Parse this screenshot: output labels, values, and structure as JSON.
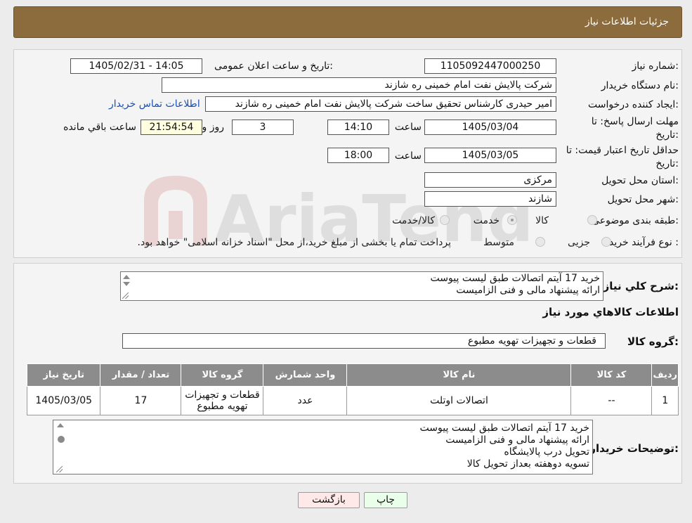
{
  "header": {
    "title": "جزئیات اطلاعات نیاز"
  },
  "form": {
    "need_number": {
      "label": "شماره نیاز:",
      "value": "1105092447000250"
    },
    "announce_datetime": {
      "label": "تاریخ و ساعت اعلان عمومی:",
      "value": "1405/02/31 - 14:05"
    },
    "buyer_org": {
      "label": "نام دستگاه خریدار:",
      "value": "شرکت پالایش نفت امام خمینی  ره  شازند"
    },
    "requester": {
      "label": "ایجاد کننده درخواست:",
      "value": "امیر  حیدری کارشناس تحقیق ساخت شرکت پالایش نفت امام خمینی  ره  شازند",
      "contact_link": "اطلاعات تماس خریدار"
    },
    "reply_deadline": {
      "label": "مهلت ارسال پاسخ: تا",
      "label2": "تاریخ:",
      "date": "1405/03/04",
      "time_label": "ساعت",
      "time": "14:10",
      "days": "3",
      "days_label": "روز و",
      "remaining": "21:54:54",
      "remaining_label": "ساعت باقي مانده"
    },
    "price_validity": {
      "label": "حداقل تاریخ اعتبار قیمت: تا",
      "label2": "تاریخ:",
      "date": "1405/03/05",
      "time_label": "ساعت",
      "time": "18:00"
    },
    "province": {
      "label": "استان محل تحویل:",
      "value": "مرکزی"
    },
    "city": {
      "label": "شهر محل تحویل:",
      "value": "شازند"
    },
    "category": {
      "label": "طبقه بندی موضوعی:",
      "options": [
        "کالا",
        "خدمت",
        "کالا/خدمت"
      ]
    },
    "purchase_type": {
      "label": "نوع فرآیند خرید :",
      "options": [
        "جزیی",
        "متوسط"
      ],
      "note": "پرداخت تمام یا بخشی از مبلغ خرید،از محل \"اسناد خزانه اسلامی\" خواهد بود."
    }
  },
  "summary": {
    "label": "شرح كلي نياز:",
    "lines": [
      "خرید 17 آیتم اتصالات طبق لیست پیوست",
      "ارائه پیشنهاد مالی و فنی الزامیست"
    ]
  },
  "items_section": {
    "title": "اطلاعات كالاهاي مورد نياز",
    "group_label": "گروه كالا:",
    "group_value": "قطعات و تجهیزات تهویه مطبوع"
  },
  "table": {
    "headers": [
      "ردیف",
      "کد کالا",
      "نام کالا",
      "واحد شمارش",
      "گروه کالا",
      "تعداد / مقدار",
      "تاریخ نیاز"
    ],
    "row": [
      "1",
      "--",
      "اتصالات اوتلت",
      "عدد",
      "قطعات و تجهیزات تهویه مطبوع",
      "17",
      "1405/03/05"
    ]
  },
  "buyer_notes": {
    "label": "توضیحات خریدار:",
    "lines": [
      "خرید 17 آیتم اتصالات طبق لیست پیوست",
      "ارائه پیشنهاد مالی و فنی الزامیست",
      "تحویل درب پالایشگاه",
      "تسویه دوهفته بعداز تحویل کالا"
    ]
  },
  "buttons": {
    "print": "چاپ",
    "back": "بازگشت"
  },
  "colors": {
    "header": "#8c6b3c",
    "table_header": "#8c8c8c",
    "back_button": "#ffe8e8",
    "print_button": "#eaffea"
  },
  "watermark": {
    "text": "AriaTender.neT"
  }
}
